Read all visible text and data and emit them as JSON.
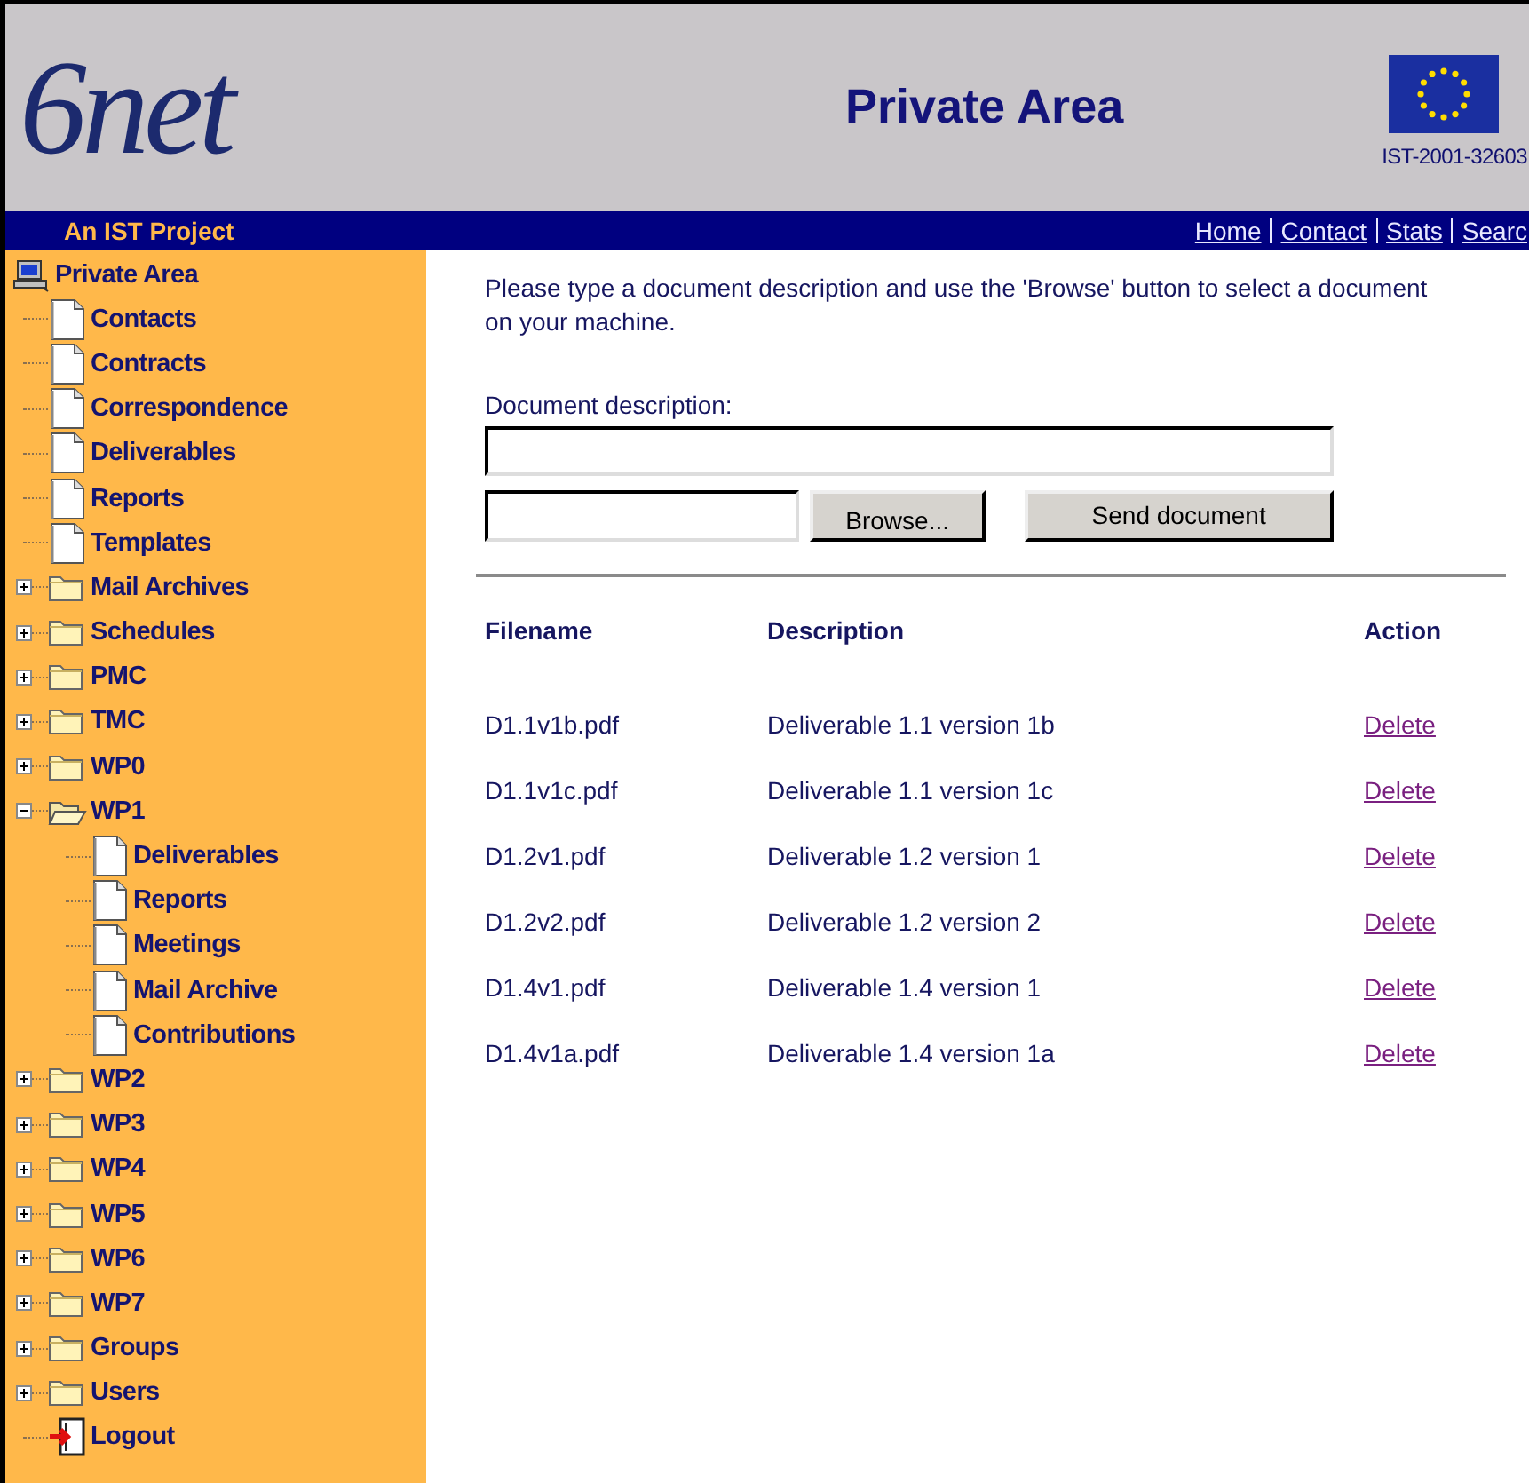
{
  "header": {
    "logo": "6net",
    "title": "Private Area",
    "project_code": "IST-2001-32603"
  },
  "nav_bar": {
    "tagline": "An IST Project",
    "links": [
      "Home",
      "Contact",
      "Stats",
      "Searc"
    ]
  },
  "sidebar": {
    "tree": [
      {
        "label": "Private Area",
        "kind": "root",
        "children": [
          {
            "label": "Contacts",
            "kind": "doc"
          },
          {
            "label": "Contracts",
            "kind": "doc"
          },
          {
            "label": "Correspondence",
            "kind": "doc"
          },
          {
            "label": "Deliverables",
            "kind": "doc"
          },
          {
            "label": "Reports",
            "kind": "doc"
          },
          {
            "label": "Templates",
            "kind": "doc"
          },
          {
            "label": "Mail Archives",
            "kind": "folder",
            "expanded": false
          },
          {
            "label": "Schedules",
            "kind": "folder",
            "expanded": false
          },
          {
            "label": "PMC",
            "kind": "folder",
            "expanded": false
          },
          {
            "label": "TMC",
            "kind": "folder",
            "expanded": false
          },
          {
            "label": "WP0",
            "kind": "folder",
            "expanded": false
          },
          {
            "label": "WP1",
            "kind": "folder",
            "expanded": true,
            "children": [
              {
                "label": "Deliverables",
                "kind": "doc"
              },
              {
                "label": "Reports",
                "kind": "doc"
              },
              {
                "label": "Meetings",
                "kind": "doc"
              },
              {
                "label": "Mail Archive",
                "kind": "doc"
              },
              {
                "label": "Contributions",
                "kind": "doc"
              }
            ]
          },
          {
            "label": "WP2",
            "kind": "folder",
            "expanded": false
          },
          {
            "label": "WP3",
            "kind": "folder",
            "expanded": false
          },
          {
            "label": "WP4",
            "kind": "folder",
            "expanded": false
          },
          {
            "label": "WP5",
            "kind": "folder",
            "expanded": false
          },
          {
            "label": "WP6",
            "kind": "folder",
            "expanded": false
          },
          {
            "label": "WP7",
            "kind": "folder",
            "expanded": false
          },
          {
            "label": "Groups",
            "kind": "folder",
            "expanded": false
          },
          {
            "label": "Users",
            "kind": "folder",
            "expanded": false
          },
          {
            "label": "Logout",
            "kind": "logout"
          }
        ]
      }
    ]
  },
  "main": {
    "instructions": "Please type a document description and use the 'Browse' button to select a document on your machine.",
    "form": {
      "description_label": "Document description:",
      "browse_button": "Browse...",
      "send_button": "Send document"
    },
    "files": {
      "columns": [
        "Filename",
        "Description",
        "Action"
      ],
      "rows": [
        {
          "filename": "D1.1v1b.pdf",
          "description": "Deliverable 1.1 version 1b",
          "action": "Delete"
        },
        {
          "filename": "D1.1v1c.pdf",
          "description": "Deliverable 1.1 version 1c",
          "action": "Delete"
        },
        {
          "filename": "D1.2v1.pdf",
          "description": "Deliverable 1.2 version 1",
          "action": "Delete"
        },
        {
          "filename": "D1.2v2.pdf",
          "description": "Deliverable 1.2 version 2",
          "action": "Delete"
        },
        {
          "filename": "D1.4v1.pdf",
          "description": "Deliverable 1.4 version 1",
          "action": "Delete"
        },
        {
          "filename": "D1.4v1a.pdf",
          "description": "Deliverable 1.4 version 1a",
          "action": "Delete"
        }
      ]
    }
  }
}
